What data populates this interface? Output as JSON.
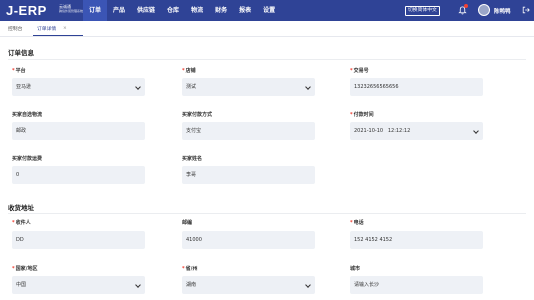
{
  "header": {
    "logo": "J-ERP",
    "logo_sub_line1": "云诚通",
    "logo_sub_line2": "跨境外贸管理系统",
    "nav": [
      "订单",
      "产品",
      "供应链",
      "仓库",
      "物流",
      "财务",
      "报表",
      "设置"
    ],
    "active_nav": "订单",
    "lang_button": "切换简体中文",
    "user_name": "陈鸭鸭"
  },
  "tabs": {
    "items": [
      "控制台",
      "订单详情"
    ],
    "active": "订单详情",
    "close_icon": "×"
  },
  "order_info": {
    "title": "订单信息",
    "fields": {
      "platform": {
        "label": "平台",
        "value": "亚马逊",
        "required": true
      },
      "store": {
        "label": "店铺",
        "value": "测试",
        "required": true
      },
      "trade_no": {
        "label": "交易号",
        "value": "13232656565656",
        "required": true
      },
      "buyer_logistics": {
        "label": "买家自选物流",
        "value": "邮政",
        "required": false
      },
      "payment_method": {
        "label": "买家付款方式",
        "value": "支付宝",
        "required": false
      },
      "payment_time": {
        "label": "付款时间",
        "value": "2021-10-10   12:12:12",
        "required": true
      },
      "buyer_shipping": {
        "label": "买家付款运费",
        "value": "0",
        "required": false
      },
      "buyer_name": {
        "label": "买家姓名",
        "value": "李哥",
        "required": false
      }
    }
  },
  "address": {
    "title": "收货地址",
    "fields": {
      "recipient": {
        "label": "收件人",
        "value": "DD",
        "required": true
      },
      "postcode": {
        "label": "邮编",
        "value": "41000",
        "required": false
      },
      "phone": {
        "label": "电话",
        "value": "152 4152 4152",
        "required": true
      },
      "country": {
        "label": "国家/地区",
        "value": "中国",
        "required": true
      },
      "province": {
        "label": "省/州",
        "value": "湖南",
        "required": true
      },
      "city": {
        "label": "城市",
        "value": "请输入长沙",
        "required": false
      }
    }
  },
  "colors": {
    "primary": "#2f4396",
    "required": "#f04134",
    "field_bg": "#edf0f5"
  },
  "icons": [
    "bell-icon",
    "logout-icon",
    "chevron-down-icon",
    "close-icon"
  ]
}
